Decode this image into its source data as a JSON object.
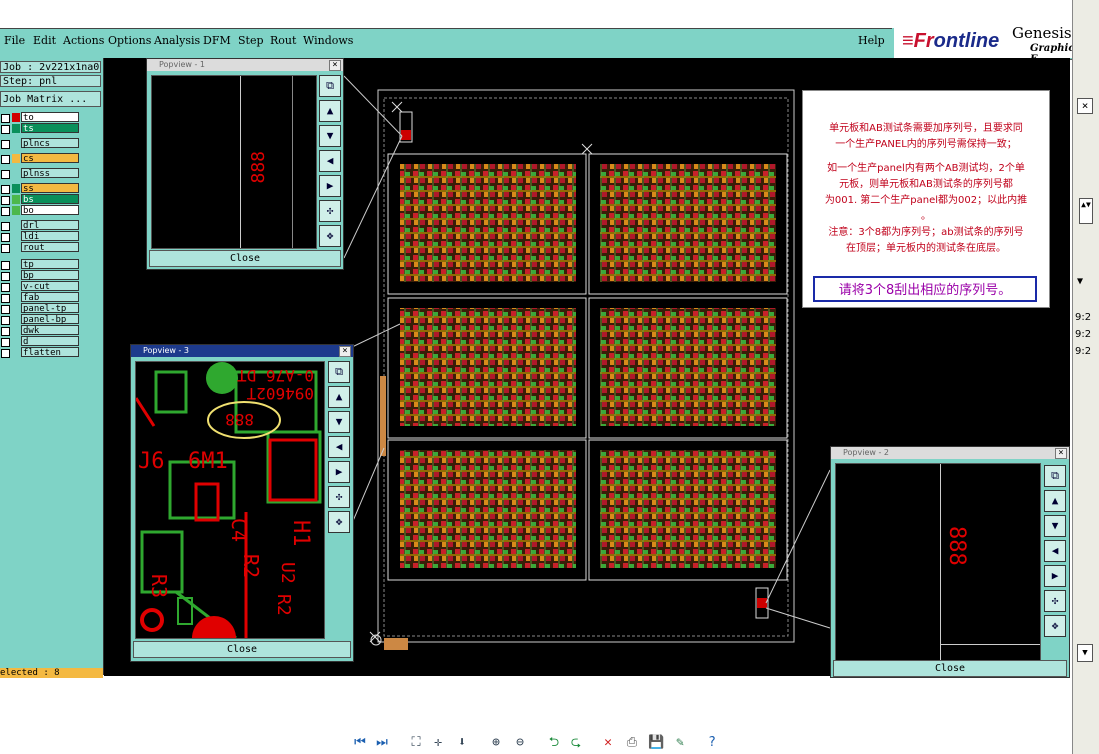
{
  "menubar": {
    "items": [
      "File",
      "Edit",
      "Actions",
      "Options",
      "Analysis",
      "DFM",
      "Step",
      "Rout",
      "Windows"
    ],
    "help": "Help"
  },
  "brand": {
    "logo_a": "≡Fr",
    "logo_b": "ontline",
    "product": "Genesis",
    "product_sub": "Graphic E"
  },
  "left": {
    "job": "Job : 2v221x1na0",
    "step": "Step: pnl",
    "matrix_button": "Job Matrix ...",
    "layers": [
      {
        "name": "to",
        "color": "#ffffff",
        "swatch": "#d00000"
      },
      {
        "name": "ts",
        "color": "#0a8f5a",
        "swatch": "#0a8f5a"
      },
      {
        "name": "plncs",
        "color": "#aee4dc",
        "swatch": ""
      },
      {
        "name": "cs",
        "color": "#f4b942",
        "swatch": "#f4b942"
      },
      {
        "name": "plnss",
        "color": "#aee4dc",
        "swatch": ""
      },
      {
        "name": "ss",
        "color": "#f4b942",
        "swatch": "#0a8f5a"
      },
      {
        "name": "bs",
        "color": "#0a8f5a",
        "swatch": "#4cb84c"
      },
      {
        "name": "bo",
        "color": "#ffffff",
        "swatch": "#4cb84c"
      },
      {
        "name": "drl",
        "color": "#aee4dc",
        "swatch": ""
      },
      {
        "name": "ldi",
        "color": "#aee4dc",
        "swatch": ""
      },
      {
        "name": "rout",
        "color": "#aee4dc",
        "swatch": ""
      },
      {
        "name": "tp",
        "color": "#aee4dc",
        "swatch": ""
      },
      {
        "name": "bp",
        "color": "#aee4dc",
        "swatch": ""
      },
      {
        "name": "v-cut",
        "color": "#aee4dc",
        "swatch": ""
      },
      {
        "name": "fab",
        "color": "#aee4dc",
        "swatch": ""
      },
      {
        "name": "panel-tp",
        "color": "#aee4dc",
        "swatch": ""
      },
      {
        "name": "panel-bp",
        "color": "#aee4dc",
        "swatch": ""
      },
      {
        "name": "dwk",
        "color": "#aee4dc",
        "swatch": ""
      },
      {
        "name": "d",
        "color": "#aee4dc",
        "swatch": ""
      },
      {
        "name": "flatten",
        "color": "#aee4dc",
        "swatch": ""
      }
    ],
    "selected": "elected : 8"
  },
  "popview1": {
    "title": "Popview - 1",
    "close": "Close",
    "digits": "888"
  },
  "popview2": {
    "title": "Popview - 2",
    "close": "Close",
    "digits": "888"
  },
  "popview3": {
    "title": "Popview - 3",
    "close": "Close"
  },
  "note": {
    "line1": "单元板和AB测试条需要加序列号，且要求同",
    "line2": "一个生产PANEL内的序列号需保持一致；",
    "line3": "如一个生产panel内有两个AB测试均，2个单",
    "line4": "元板，则单元板和AB测试条的序列号都",
    "line5": "为001. 第二个生产panel都为002；以此内推",
    "line6": "。",
    "line7": "注意：3个8都为序列号；ab测试条的序列号",
    "line8": "在顶层；单元板内的测试条在底层。",
    "highlight": "请将3个8刮出相应的序列号。"
  },
  "pop3_text": {
    "t1": "0-A76 DT",
    "t2": "094602T",
    "t3": "J6",
    "t4": "6M1",
    "t5": "C4",
    "t6": "R2",
    "t7": "H1",
    "t8": "U2",
    "t9": "R3",
    "t10": "R2",
    "t11": "888"
  },
  "rightbar": {
    "times": [
      "9:2",
      "9:2",
      "9:2"
    ]
  },
  "colors": {
    "accent": "#7fd3c6",
    "canvas": "#000000",
    "title_bar": "#1d3a8c"
  }
}
